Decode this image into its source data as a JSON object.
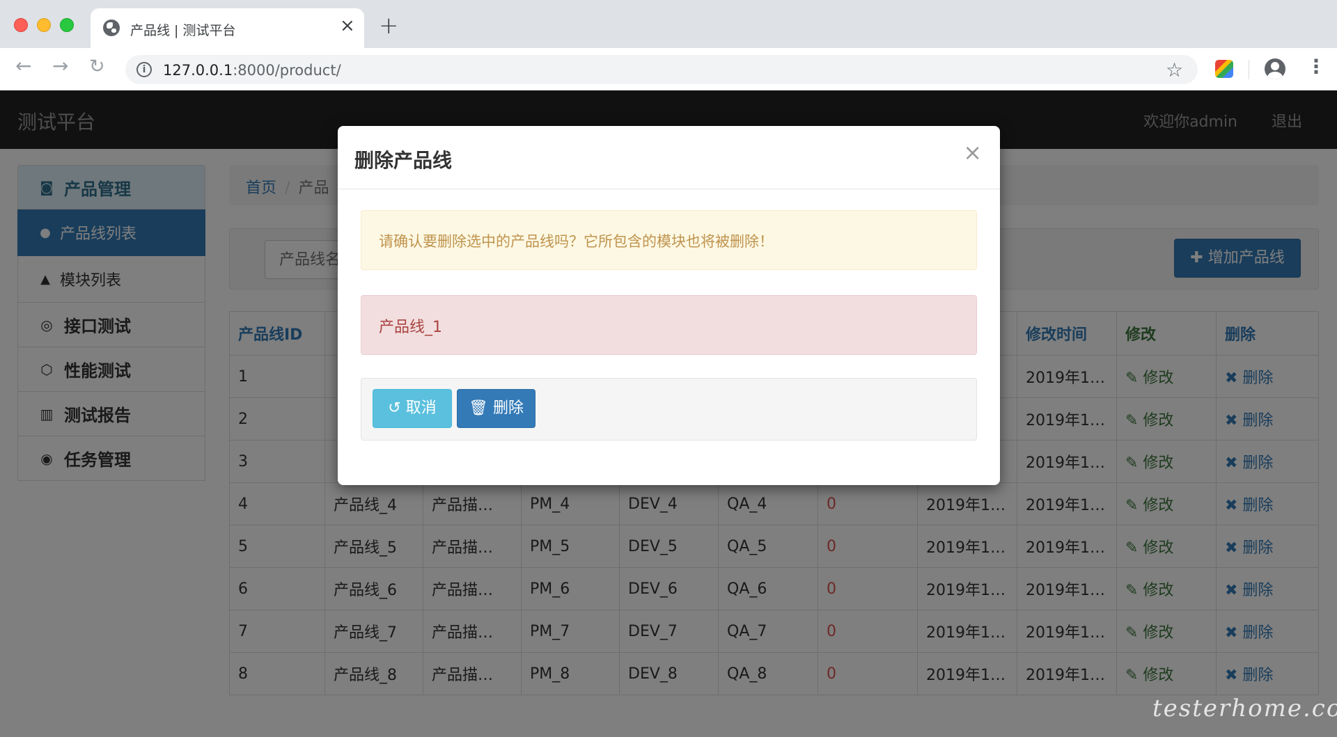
{
  "browser": {
    "tab_title": "产品线 | 测试平台",
    "tab_close": "×",
    "new_tab": "+",
    "url_host": "127.0.0.1",
    "url_rest": ":8000/product/"
  },
  "navbar": {
    "brand": "测试平台",
    "user": "欢迎你admin",
    "logout": "退出"
  },
  "sidebar": {
    "items": [
      {
        "label": "产品管理",
        "icon": "github-icon"
      },
      {
        "label": "产品线列表",
        "icon": "apple-icon"
      },
      {
        "label": "模块列表",
        "icon": "android-icon"
      },
      {
        "label": "接口测试",
        "icon": "github-icon"
      },
      {
        "label": "性能测试",
        "icon": "html5-icon"
      },
      {
        "label": "测试报告",
        "icon": "bar-chart-icon"
      },
      {
        "label": "任务管理",
        "icon": "cat-icon"
      }
    ]
  },
  "breadcrumb": {
    "home": "首页",
    "sep": "/",
    "current": "产品"
  },
  "search": {
    "placeholder": "产品线名"
  },
  "add_button": "✚ 增加产品线",
  "table": {
    "headers": [
      "产品线ID",
      "",
      "",
      "",
      "",
      "",
      "",
      "",
      "修改时间",
      "修改",
      "删除"
    ],
    "edit_label": "✎ 修改",
    "delete_label": "✖ 删除",
    "rows": [
      {
        "id": "1",
        "name": "",
        "desc": "",
        "pm": "",
        "dev": "",
        "qa": "",
        "count": "",
        "created": "",
        "modified": "2019年1…"
      },
      {
        "id": "2",
        "name": "",
        "desc": "",
        "pm": "",
        "dev": "",
        "qa": "",
        "count": "",
        "created": "",
        "modified": "2019年1…"
      },
      {
        "id": "3",
        "name": "",
        "desc": "",
        "pm": "",
        "dev": "",
        "qa": "",
        "count": "",
        "created": "",
        "modified": "2019年1…"
      },
      {
        "id": "4",
        "name": "产品线_4",
        "desc": "产品描…",
        "pm": "PM_4",
        "dev": "DEV_4",
        "qa": "QA_4",
        "count": "0",
        "created": "2019年1…",
        "modified": "2019年1…"
      },
      {
        "id": "5",
        "name": "产品线_5",
        "desc": "产品描…",
        "pm": "PM_5",
        "dev": "DEV_5",
        "qa": "QA_5",
        "count": "0",
        "created": "2019年1…",
        "modified": "2019年1…"
      },
      {
        "id": "6",
        "name": "产品线_6",
        "desc": "产品描…",
        "pm": "PM_6",
        "dev": "DEV_6",
        "qa": "QA_6",
        "count": "0",
        "created": "2019年1…",
        "modified": "2019年1…"
      },
      {
        "id": "7",
        "name": "产品线_7",
        "desc": "产品描…",
        "pm": "PM_7",
        "dev": "DEV_7",
        "qa": "QA_7",
        "count": "0",
        "created": "2019年1…",
        "modified": "2019年1…"
      },
      {
        "id": "8",
        "name": "产品线_8",
        "desc": "产品描…",
        "pm": "PM_8",
        "dev": "DEV_8",
        "qa": "QA_8",
        "count": "0",
        "created": "2019年1…",
        "modified": "2019年1…"
      }
    ]
  },
  "modal": {
    "title": "删除产品线",
    "close": "×",
    "warning": "请确认要删除选中的产品线吗？它所包含的模块也将被删除！",
    "selected": "产品线_1",
    "cancel": "↺ 取消",
    "delete": "🗑 删除"
  },
  "watermark": "testerhome.com"
}
